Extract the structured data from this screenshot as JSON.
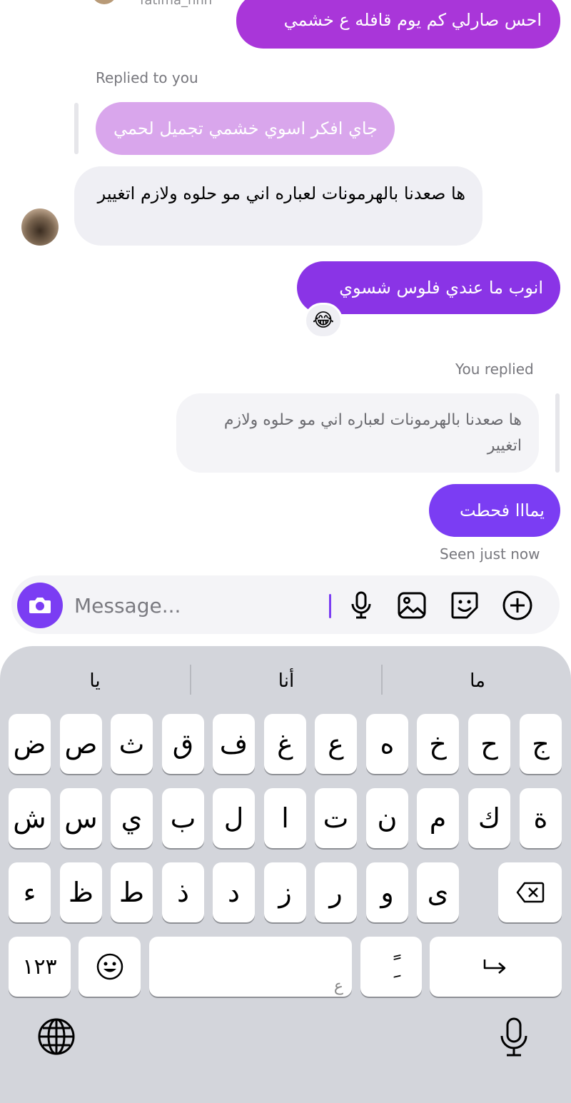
{
  "header": {
    "username": "fatima_hhh"
  },
  "messages": {
    "top_sent": "احس صارلي كم يوم قافله ع خشمي",
    "replied_to_you": "Replied to you",
    "quoted_reply": "جاي افكر اسوي خشمي تجميل لحمي",
    "received": "ها صعدنا بالهرمونات لعباره اني مو حلوه ولازم اتغيير",
    "sent_2": "انوب ما عندي فلوس شسوي",
    "reaction": "😂",
    "you_replied": "You replied",
    "quoted_own": "ها صعدنا بالهرمونات لعباره اني مو حلوه ولازم اتغيير",
    "sent_3": "يمااا فحطت",
    "seen": "Seen just now"
  },
  "composer": {
    "placeholder": "Message...",
    "icons": [
      "camera-icon",
      "microphone-icon",
      "gallery-icon",
      "sticker-icon",
      "plus-icon"
    ]
  },
  "keyboard": {
    "suggestions": [
      "ما",
      "أنا",
      "يا"
    ],
    "row1": [
      "ج",
      "ح",
      "خ",
      "ه",
      "ع",
      "غ",
      "ف",
      "ق",
      "ث",
      "ص",
      "ض"
    ],
    "row2": [
      "ة",
      "ك",
      "م",
      "ن",
      "ت",
      "ا",
      "ل",
      "ب",
      "ي",
      "س",
      "ش"
    ],
    "row3": [
      "ى",
      "و",
      "ر",
      "ز",
      "د",
      "ذ",
      "ط",
      "ظ",
      "ء"
    ],
    "numbers_label": "١٢٣",
    "diacritic_label": "ًِ",
    "space_hint": "ع"
  },
  "colors": {
    "accent": "#7b3df3",
    "bubble_purple_1": "#a936d9",
    "bubble_purple_2": "#8a34e6",
    "incoming": "#efeff4",
    "keyboard_bg": "#d3d5db"
  }
}
